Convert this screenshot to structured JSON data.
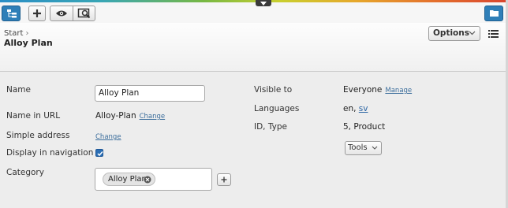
{
  "toolbar": {
    "icons": {
      "navigation_pane": "navigation-tree-icon",
      "add": "plus-icon",
      "preview": "eye-icon",
      "compare": "view-compare-icon",
      "assets_pane": "folder-icon",
      "drop_tab": "chevron-down-icon"
    }
  },
  "header": {
    "breadcrumb": "Start",
    "breadcrumb_separator": "›",
    "title": "Alloy Plan",
    "options_label": "Options"
  },
  "form": {
    "name_label": "Name",
    "name_value": "Alloy Plan",
    "url_label": "Name in URL",
    "url_value": "Alloy-Plan",
    "url_change": "Change",
    "simple_address_label": "Simple address",
    "simple_address_change": "Change",
    "display_nav_label": "Display in navigation",
    "display_nav_checked": true,
    "category_label": "Category",
    "category_tags": [
      "Alloy Plan"
    ]
  },
  "info": {
    "visible_to_label": "Visible to",
    "visible_to_value": "Everyone",
    "visible_to_manage": "Manage",
    "languages_label": "Languages",
    "languages_value": "en,",
    "languages_link": "sv",
    "id_type_label": "ID, Type",
    "id_type_value": "5, Product",
    "tools_label": "Tools"
  },
  "colors": {
    "accent_blue": "#2f7fb8",
    "link": "#3c6e9c",
    "checkbox": "#2a6eb5"
  }
}
